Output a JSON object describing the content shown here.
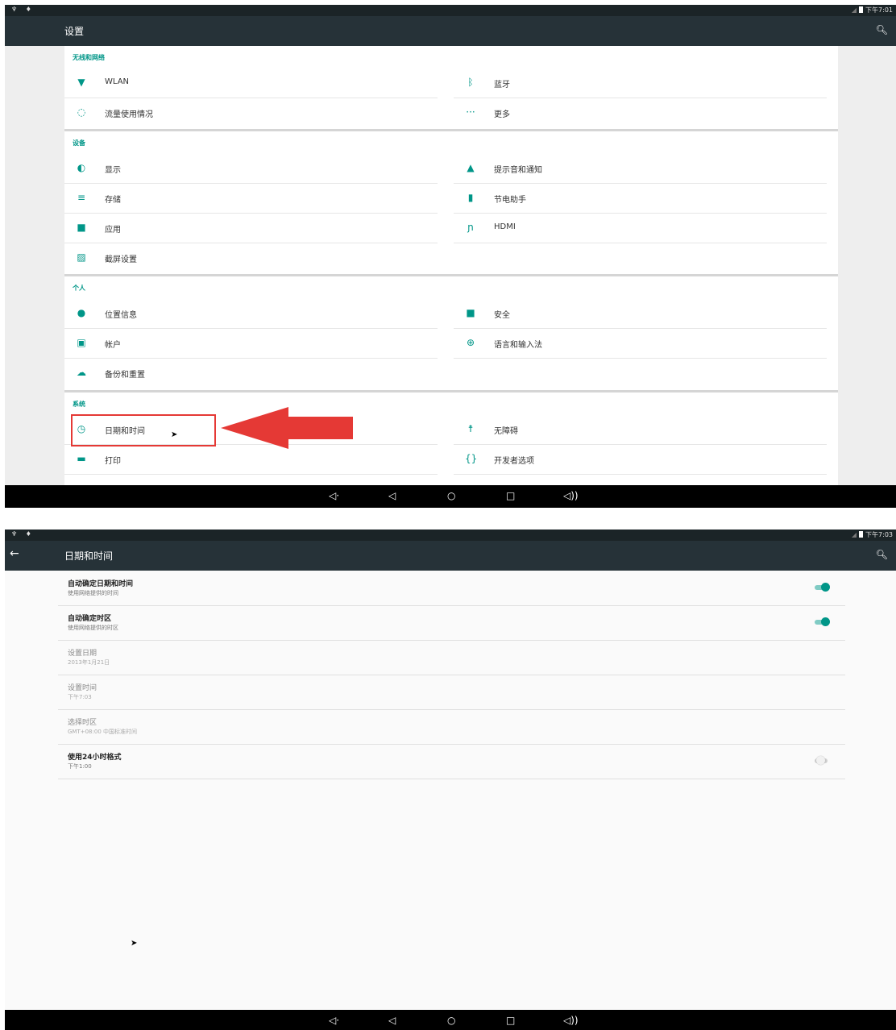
{
  "screen1": {
    "status": {
      "left_icons": "♆ ♦",
      "time": "下午7:01"
    },
    "title": "设置",
    "sections": [
      {
        "header": "无线和网络",
        "items": [
          {
            "label": "WLAN",
            "icon": "wifi-icon"
          },
          {
            "label": "蓝牙",
            "icon": "bluetooth-icon"
          },
          {
            "label": "流量使用情况",
            "icon": "data-usage-icon"
          },
          {
            "label": "更多",
            "icon": "more-icon"
          }
        ]
      },
      {
        "header": "设备",
        "items": [
          {
            "label": "显示",
            "icon": "brightness-icon"
          },
          {
            "label": "提示音和通知",
            "icon": "bell-icon"
          },
          {
            "label": "存储",
            "icon": "storage-icon"
          },
          {
            "label": "节电助手",
            "icon": "battery-icon"
          },
          {
            "label": "应用",
            "icon": "android-icon"
          },
          {
            "label": "HDMI",
            "icon": "hdmi-icon"
          },
          {
            "label": "截屏设置",
            "icon": "screenshot-icon"
          }
        ]
      },
      {
        "header": "个人",
        "items": [
          {
            "label": "位置信息",
            "icon": "location-icon"
          },
          {
            "label": "安全",
            "icon": "lock-icon"
          },
          {
            "label": "帐户",
            "icon": "account-icon"
          },
          {
            "label": "语言和输入法",
            "icon": "globe-icon"
          },
          {
            "label": "备份和重置",
            "icon": "cloud-icon"
          }
        ]
      },
      {
        "header": "系统",
        "items": [
          {
            "label": "日期和时间",
            "icon": "clock-icon"
          },
          {
            "label": "无障碍",
            "icon": "accessibility-icon"
          },
          {
            "label": "打印",
            "icon": "print-icon"
          },
          {
            "label": "开发者选项",
            "icon": "developer-icon"
          }
        ]
      }
    ]
  },
  "screen2": {
    "status": {
      "left_icons": "♆ ♦",
      "time": "下午7:03"
    },
    "title": "日期和时间",
    "rows": [
      {
        "title": "自动确定日期和时间",
        "summary": "使用网络提供的时间",
        "toggle": true
      },
      {
        "title": "自动确定时区",
        "summary": "使用网络提供的时区",
        "toggle": true
      },
      {
        "title": "设置日期",
        "summary": "2013年1月21日"
      },
      {
        "title": "设置时间",
        "summary": "下午7:03"
      },
      {
        "title": "选择时区",
        "summary": "GMT+08:00 中国标准时间"
      },
      {
        "title": "使用24小时格式",
        "summary": "下午1:00",
        "toggle": false
      }
    ]
  },
  "colors": {
    "accent": "#009688",
    "appbar": "#263238",
    "highlight": "#e53935"
  }
}
